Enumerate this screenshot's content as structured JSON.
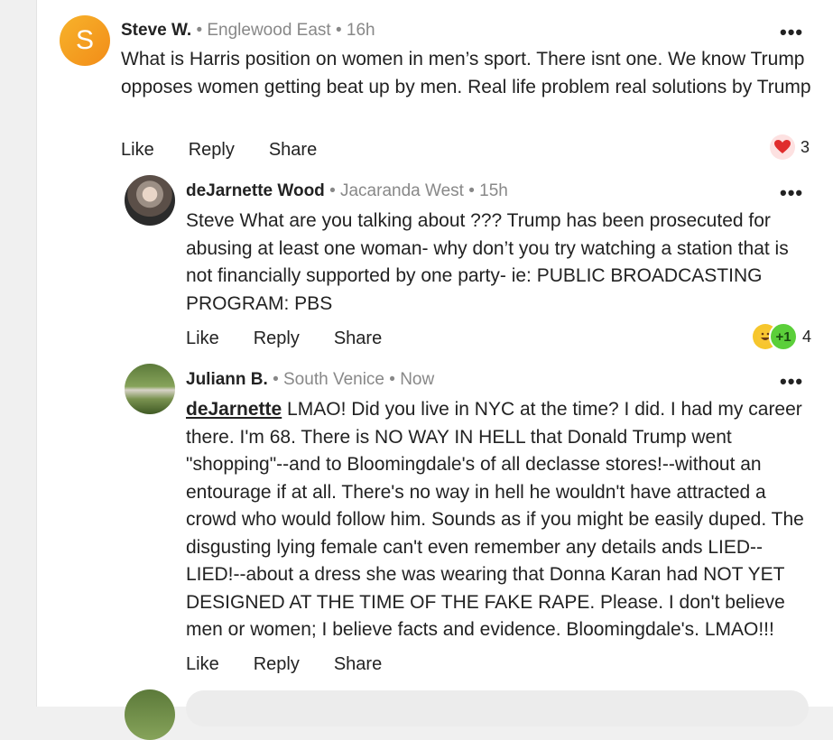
{
  "comments": [
    {
      "avatar_letter": "S",
      "name": "Steve W.",
      "meta": "• Englewood East • 16h",
      "text": "What is Harris position on women in men’s sport. There isnt one. We know Trump opposes women getting beat up by men. Real life problem real solutions by Trump",
      "actions": {
        "like": "Like",
        "reply": "Reply",
        "share": "Share"
      },
      "reaction_icon": "heart-icon",
      "reaction_count": "3"
    },
    {
      "name": "deJarnette Wood",
      "meta": "• Jacaranda West • 15h",
      "text": "Steve What are you talking about ??? Trump has been prosecuted for abusing at least one woman- why don’t you try watching a station that is not financially supported by one party- ie: PUBLIC BROADCASTING PROGRAM: PBS",
      "actions": {
        "like": "Like",
        "reply": "Reply",
        "share": "Share"
      },
      "reaction_icon": "laugh-and-plus-one-icons",
      "reaction_badge": "+1",
      "reaction_count": "4"
    },
    {
      "name": "Juliann B.",
      "meta": "• South Venice • Now",
      "mention": "deJarnette",
      "text": " LMAO!  Did you live in NYC at the time? I did. I had my career there.  I'm 68. There is NO WAY IN HELL that Donald Trump went \"shopping\"--and to Bloomingdale's of all declasse stores!--without an entourage if at all. There's no way in hell he wouldn't have attracted a crowd who would follow him. Sounds as if you might be easily duped. The disgusting lying female can't even remember any details ands LIED--LIED!--about a dress she was wearing that Donna Karan had NOT YET DESIGNED AT THE TIME OF THE FAKE RAPE. Please. I don't believe men or women; I believe facts and evidence. Bloomingdale's. LMAO!!!",
      "actions": {
        "like": "Like",
        "reply": "Reply",
        "share": "Share"
      }
    }
  ],
  "more_icon": "•••",
  "colors": {
    "accent_avatar": "#f4a020",
    "meta": "#888888",
    "reply_box": "#ececec"
  }
}
